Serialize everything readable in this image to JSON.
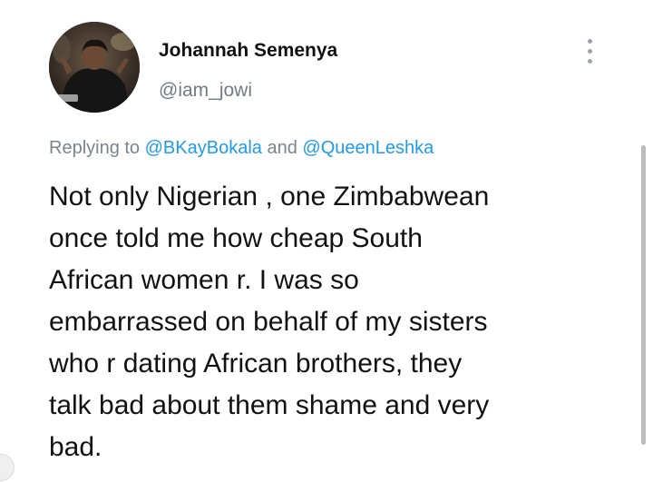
{
  "tweet": {
    "author": {
      "display_name": "Johannah Semenya",
      "handle": "@iam_jowi",
      "avatar_icon": "profile-photo"
    },
    "more_icon": "vertical-dots-icon",
    "reply": {
      "prefix": "Replying to",
      "mention_1": "@BKayBokala",
      "joiner": "and",
      "mention_2": "@QueenLeshka"
    },
    "text": "Not only Nigerian , one Zimbabwean\nonce told me how cheap South\nAfrican women r. I was so\nembarrassed on behalf of my sisters\nwho r dating African brothers, they\ntalk bad about them shame and very\nbad."
  },
  "colors": {
    "background": "#ffffff",
    "mention": "#1d9bf0",
    "secondary_text": "#7a8590",
    "primary_text": "#121212"
  }
}
